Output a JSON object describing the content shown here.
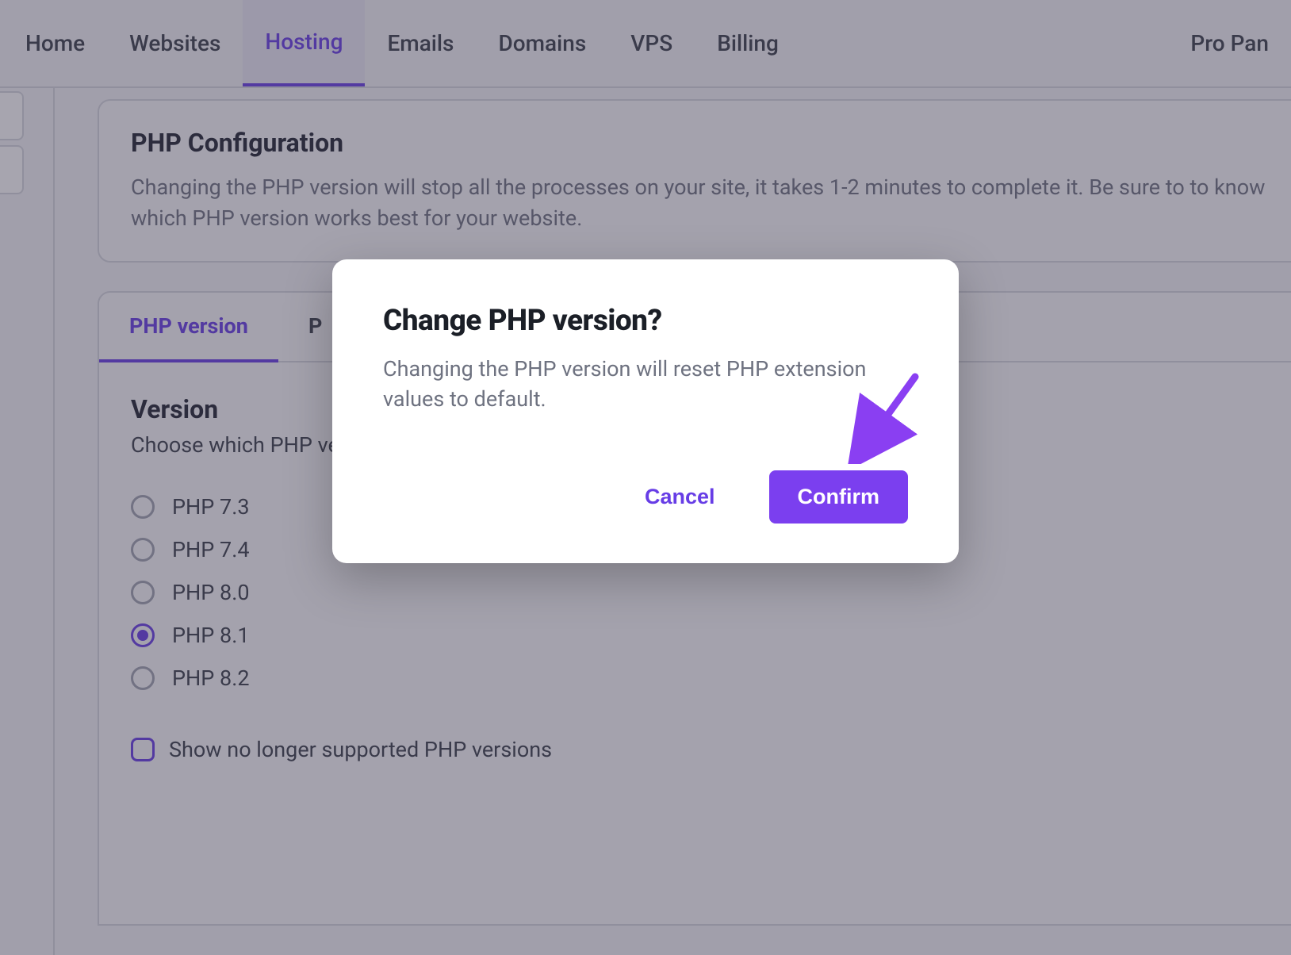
{
  "nav": {
    "items": [
      {
        "label": "Home"
      },
      {
        "label": "Websites"
      },
      {
        "label": "Hosting",
        "active": true
      },
      {
        "label": "Emails"
      },
      {
        "label": "Domains"
      },
      {
        "label": "VPS"
      },
      {
        "label": "Billing"
      }
    ],
    "right_label": "Pro Pan"
  },
  "config_card": {
    "title": "PHP Configuration",
    "desc": "Changing the PHP version will stop all the processes on your site, it takes 1-2 minutes to complete it. Be sure to to know which PHP version works best for your website."
  },
  "tabs": {
    "items": [
      {
        "label": "PHP version",
        "active": true
      },
      {
        "label": "P"
      }
    ]
  },
  "version_panel": {
    "heading": "Version",
    "sub": "Choose which PHP ve",
    "options": [
      {
        "label": "PHP 7.3",
        "selected": false
      },
      {
        "label": "PHP 7.4",
        "selected": false
      },
      {
        "label": "PHP 8.0",
        "selected": false
      },
      {
        "label": "PHP 8.1",
        "selected": true
      },
      {
        "label": "PHP 8.2",
        "selected": false
      }
    ],
    "show_unsupported_label": "Show no longer supported PHP versions",
    "show_unsupported_checked": false
  },
  "modal": {
    "title": "Change PHP version?",
    "body": "Changing the PHP version will reset PHP extension values to default.",
    "cancel": "Cancel",
    "confirm": "Confirm"
  },
  "colors": {
    "accent": "#673de6",
    "accent_bright": "#7b3fef"
  }
}
